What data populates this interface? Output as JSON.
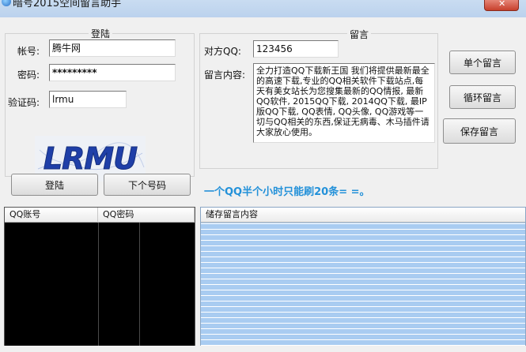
{
  "window": {
    "title": "暗号2015空间留言助手"
  },
  "login": {
    "legend": "登陆",
    "account_label": "帐号:",
    "account_value": "腾牛网",
    "password_label": "密码:",
    "password_value": "*********",
    "captcha_label": "验证码:",
    "captcha_value": "lrmu",
    "captcha_image_text": "LRMU",
    "login_button": "登陆",
    "next_account_button": "下个号码"
  },
  "message": {
    "legend": "留言",
    "target_qq_label": "对方QQ:",
    "target_qq_value": "123456",
    "content_label": "留言内容:",
    "content_value": "全力打造QQ下载新王国 我们将提供最新最全的高速下载,专业的QQ相关软件下载站点,每天有美女站长为您搜集最新的QQ情报, 最新QQ软件, 2015QQ下载, 2014QQ下载, 最IP版QQ下载, QQ表情, QQ头像, QQ游戏等一切与QQ相关的东西,保证无病毒、木马插件请大家放心使用。"
  },
  "actions": {
    "single_message_button": "单个留言",
    "loop_message_button": "循环留言",
    "save_message_button": "保存留言"
  },
  "notice": "一个QQ半个小时只能刷20条= =。",
  "account_list": {
    "columns": [
      "QQ账号",
      "QQ密码"
    ]
  },
  "store_list": {
    "columns": [
      "储存留言内容"
    ]
  },
  "colors": {
    "highlight_border": "#d21c1c",
    "notice_text": "#2391d9",
    "store_row": "#a9ccf1",
    "captcha_text": "#1f3fa8"
  }
}
